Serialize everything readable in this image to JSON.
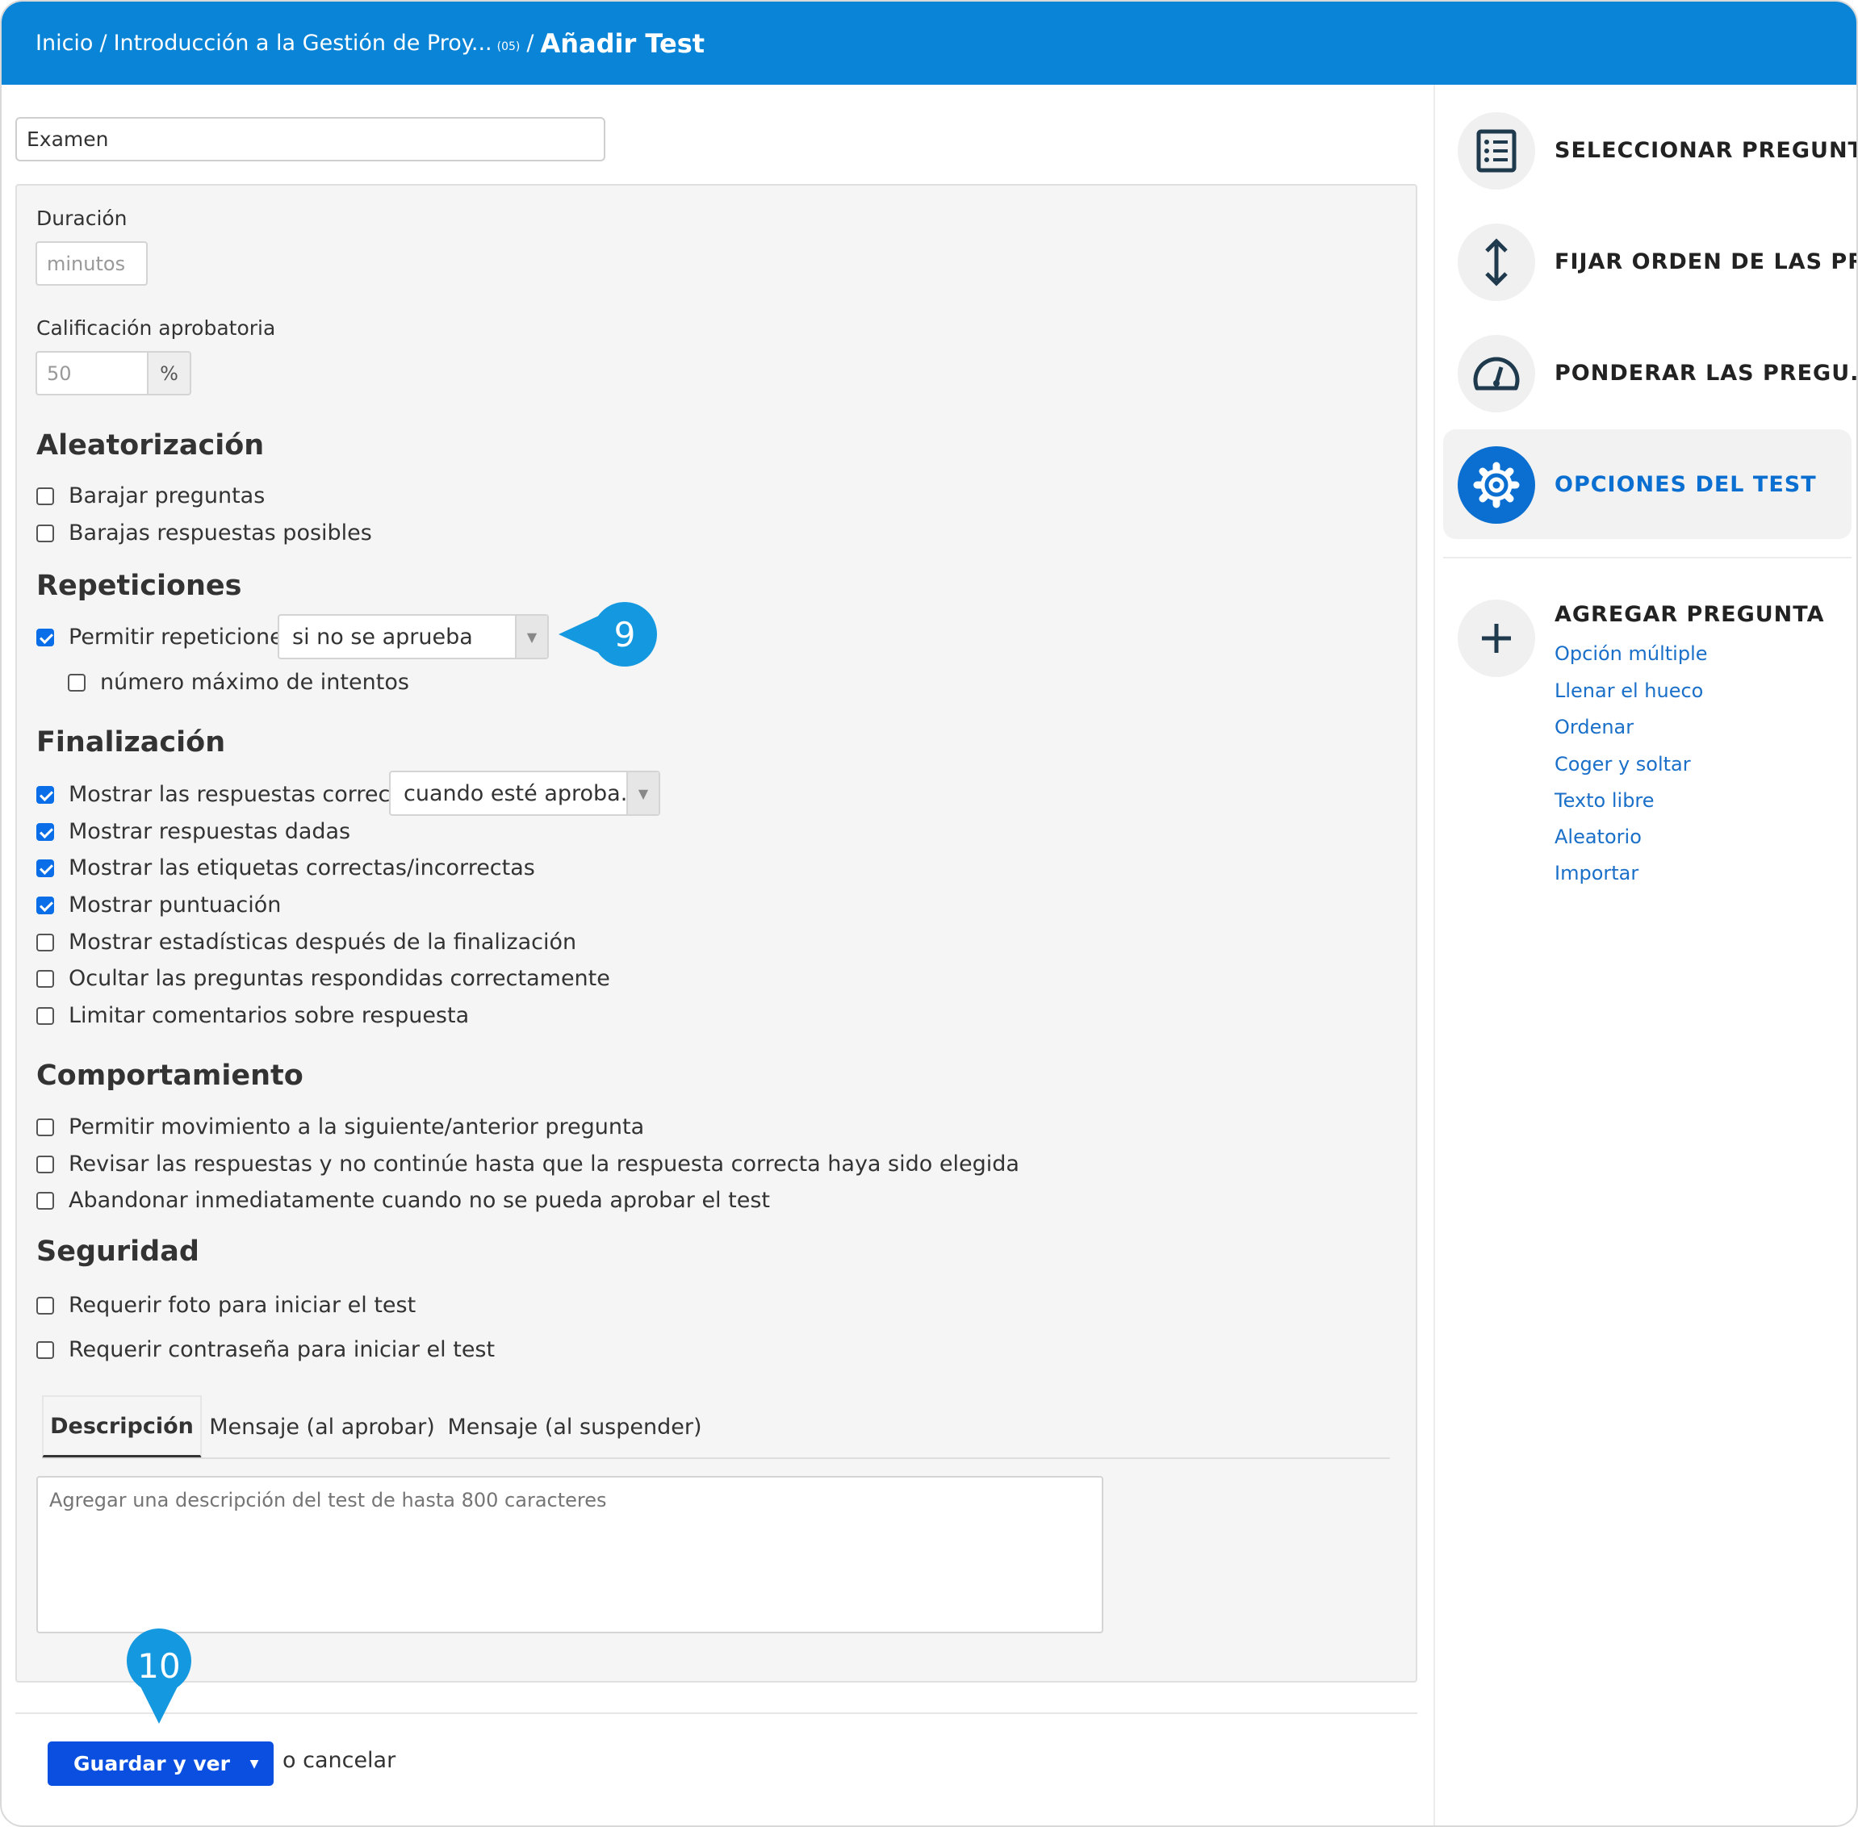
{
  "header": {
    "crumb_home": "Inicio",
    "crumb_course": "Introducción a la Gestión de Proy...",
    "crumb_course_small": "(05)",
    "separator": "/",
    "current": "Añadir Test"
  },
  "title_input": {
    "value": "Examen"
  },
  "duration": {
    "label": "Duración",
    "placeholder": "minutos"
  },
  "passing": {
    "label": "Calificación aprobatoria",
    "value": "50",
    "unit": "%"
  },
  "randomization": {
    "title": "Aleatorización",
    "options": [
      {
        "label": "Barajar preguntas",
        "checked": false
      },
      {
        "label": "Barajas respuestas posibles",
        "checked": false
      }
    ]
  },
  "repetitions": {
    "title": "Repeticiones",
    "allow_label": "Permitir repeticiones",
    "allow_checked": true,
    "mode_value": "si no se aprueba",
    "max_attempts_label": "número máximo de intentos",
    "max_attempts_checked": false
  },
  "finalization": {
    "title": "Finalización",
    "options": [
      {
        "label": "Mostrar las respuestas correctas",
        "checked": true
      },
      {
        "label": "Mostrar respuestas dadas",
        "checked": true
      },
      {
        "label": "Mostrar las etiquetas correctas/incorrectas",
        "checked": true
      },
      {
        "label": "Mostrar puntuación",
        "checked": true
      },
      {
        "label": "Mostrar estadísticas después de la finalización",
        "checked": false
      },
      {
        "label": "Ocultar las preguntas respondidas correctamente",
        "checked": false
      },
      {
        "label": "Limitar comentarios sobre respuesta",
        "checked": false
      }
    ],
    "show_correct_mode": "cuando esté aproba..."
  },
  "behavior": {
    "title": "Comportamiento",
    "options": [
      {
        "label": "Permitir movimiento a la siguiente/anterior pregunta",
        "checked": false
      },
      {
        "label": "Revisar las respuestas y no continúe hasta que la respuesta correcta haya sido elegida",
        "checked": false
      },
      {
        "label": "Abandonar inmediatamente cuando no se pueda aprobar el test",
        "checked": false
      }
    ]
  },
  "security": {
    "title": "Seguridad",
    "options": [
      {
        "label": "Requerir foto para iniciar el test",
        "checked": false
      },
      {
        "label": "Requerir contraseña para iniciar el test",
        "checked": false
      }
    ]
  },
  "tabs": [
    {
      "label": "Descripción",
      "active": true
    },
    {
      "label": "Mensaje (al aprobar)",
      "active": false
    },
    {
      "label": "Mensaje (al suspender)",
      "active": false
    }
  ],
  "description": {
    "placeholder": "Agregar una descripción del test de hasta 800 caracteres"
  },
  "footer": {
    "save_label": "Guardar y ver",
    "cancel_label": "o cancelar"
  },
  "callouts": {
    "nine": "9",
    "ten": "10"
  },
  "sidebar": {
    "items": [
      {
        "label": "SELECCIONAR PREGUNT...",
        "icon": "checklist-icon",
        "active": false
      },
      {
        "label": "FIJAR ORDEN DE LAS PR...",
        "icon": "vertical-arrows-icon",
        "active": false
      },
      {
        "label": "PONDERAR LAS PREGU...",
        "icon": "gauge-icon",
        "active": false
      },
      {
        "label": "OPCIONES DEL TEST",
        "icon": "gear-icon",
        "active": true
      }
    ],
    "add_question": {
      "title": "AGREGAR PREGUNTA",
      "links": [
        "Opción múltiple",
        "Llenar el hueco",
        "Ordenar",
        "Coger y soltar",
        "Texto libre",
        "Aleatorio",
        "Importar"
      ]
    }
  },
  "colors": {
    "header": "#0a84d6",
    "primary_button": "#0a4fe0",
    "accent": "#0a6fd0",
    "callout": "#1499e0",
    "link": "#1a6fc9"
  }
}
